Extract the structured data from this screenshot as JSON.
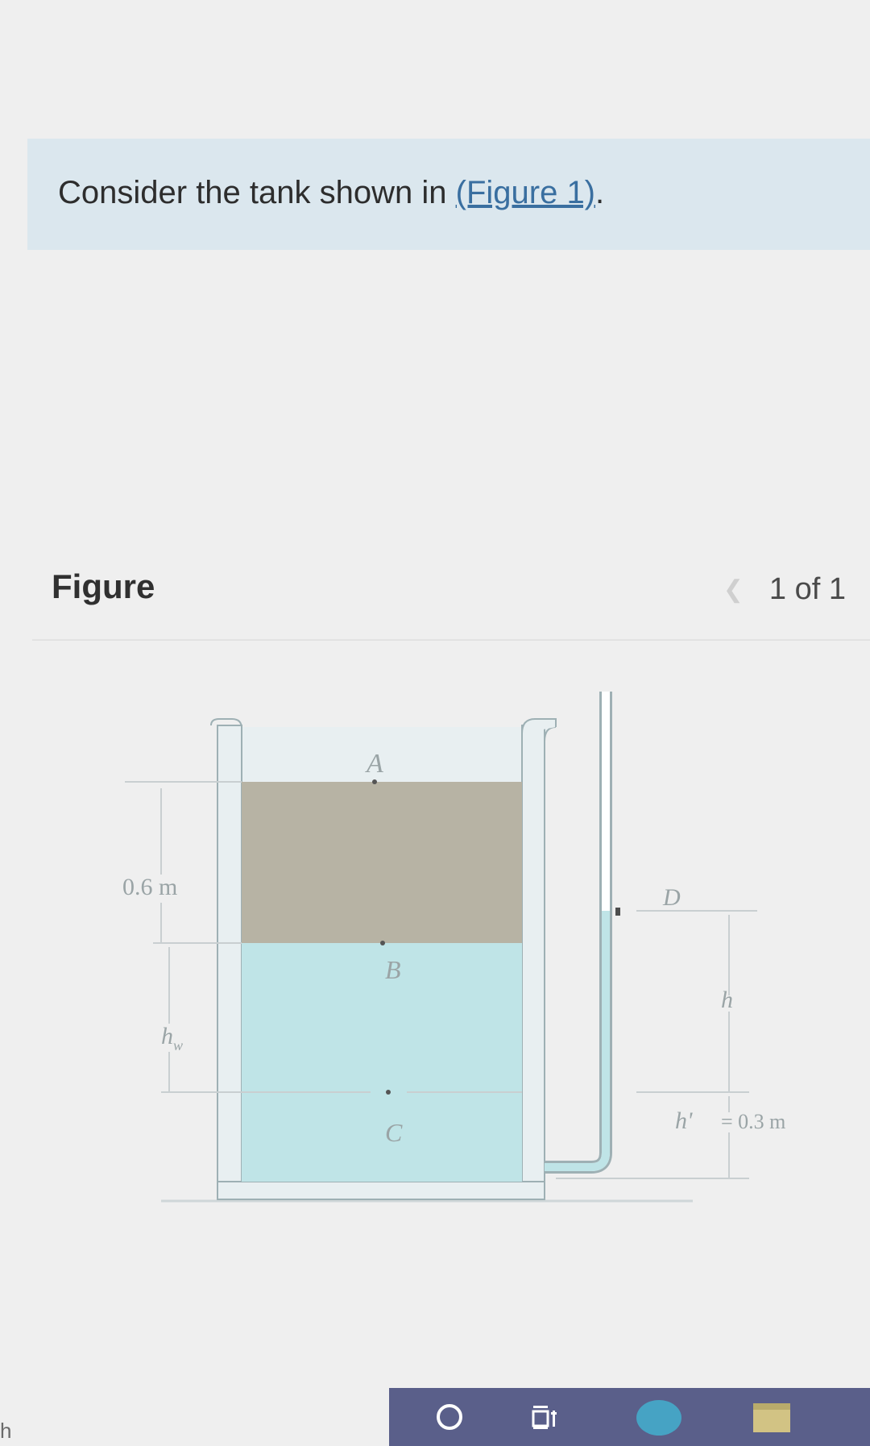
{
  "intro": {
    "before": "Consider the tank shown in ",
    "link": "(Figure 1)",
    "after": "."
  },
  "figure": {
    "heading": "Figure",
    "pagination": "1 of 1",
    "diagram": {
      "labels": {
        "a": "A",
        "b": "B",
        "c": "C",
        "d": "D",
        "top_depth": "0.6 m",
        "hw": "h",
        "hw_sub": "w",
        "h": "h",
        "h_prime": "h'",
        "h_prime_value": "= 0.3 m"
      },
      "colors": {
        "oil": "#b7b3a4",
        "water": "#bfe4e7",
        "wall": "#e6eef0",
        "outline": "#8fa3a8"
      }
    }
  },
  "taskbar": {
    "cortana_icon": "circle-icon",
    "task_view_icon": "task-view-icon"
  },
  "edge_text": "h"
}
